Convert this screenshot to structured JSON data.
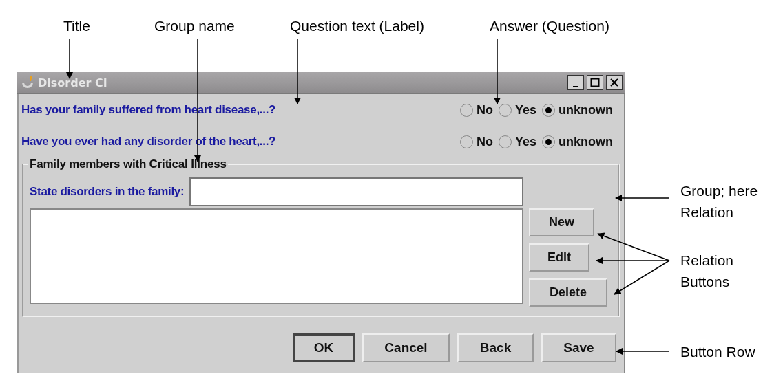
{
  "annotations": [
    {
      "text": "Title",
      "kind": "top"
    },
    {
      "text": "Group name",
      "kind": "top"
    },
    {
      "text": "Question text (Label)",
      "kind": "top"
    },
    {
      "text": "Answer (Question)",
      "kind": "top"
    },
    {
      "text": "Group; here Relation",
      "kind": "side"
    },
    {
      "text": "Relation Buttons",
      "kind": "side"
    },
    {
      "text": "Button Row",
      "kind": "side"
    }
  ],
  "window": {
    "title": "Disorder CI"
  },
  "questions": [
    {
      "label": "Has your family suffered from heart disease,...?",
      "options": [
        {
          "label": "No",
          "selected": false
        },
        {
          "label": "Yes",
          "selected": false
        },
        {
          "label": "unknown",
          "selected": true
        }
      ]
    },
    {
      "label": "Have you ever had any disorder of the heart,...?",
      "options": [
        {
          "label": "No",
          "selected": false
        },
        {
          "label": "Yes",
          "selected": false
        },
        {
          "label": "unknown",
          "selected": true
        }
      ]
    }
  ],
  "group": {
    "title": "Family members with Critical Illness",
    "field_label": "State disorders in the family:",
    "buttons": [
      "New",
      "Edit",
      "Delete"
    ]
  },
  "buttons": [
    {
      "label": "OK",
      "default": true
    },
    {
      "label": "Cancel",
      "default": false
    },
    {
      "label": "Back",
      "default": false
    },
    {
      "label": "Save",
      "default": false
    }
  ]
}
